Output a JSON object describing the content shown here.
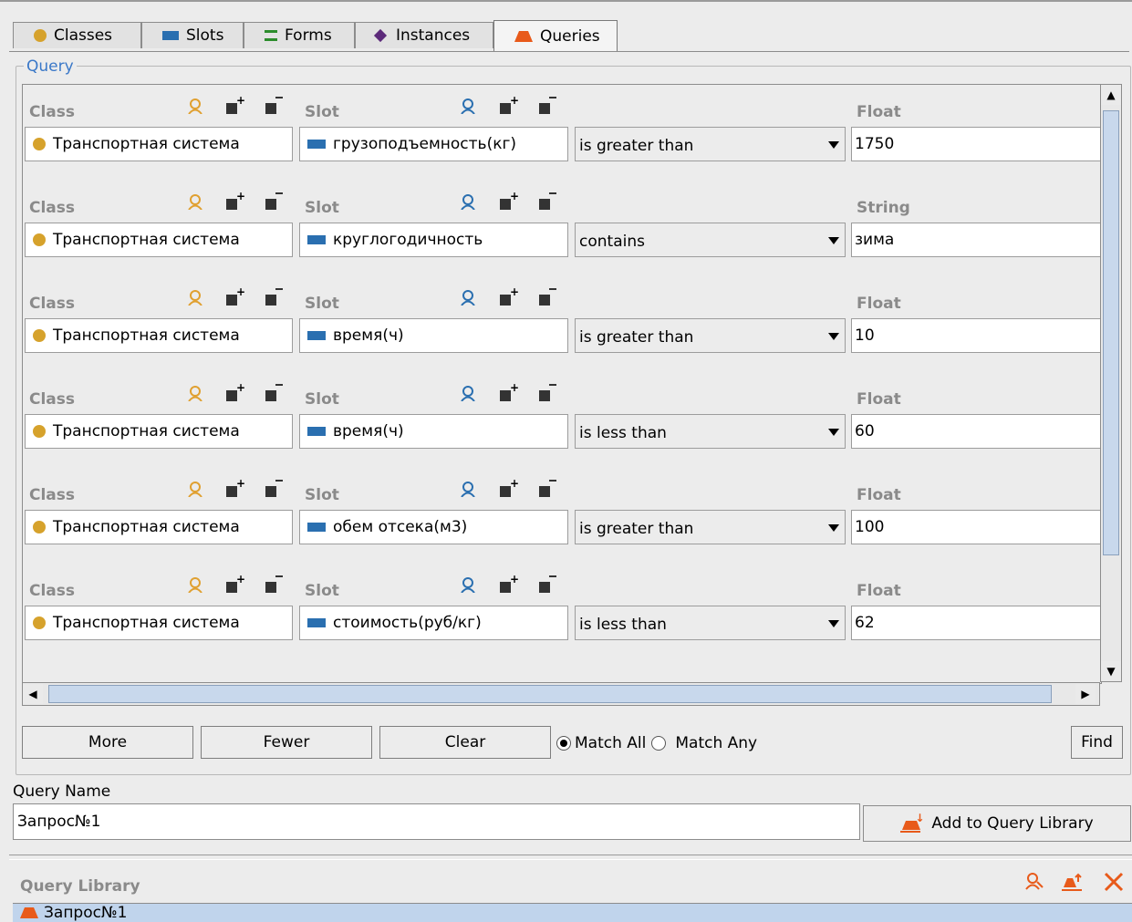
{
  "tabs": [
    {
      "label": "Classes",
      "icon": "class-dot-icon"
    },
    {
      "label": "Slots",
      "icon": "slot-icon"
    },
    {
      "label": "Forms",
      "icon": "form-icon"
    },
    {
      "label": "Instances",
      "icon": "instance-diamond-icon"
    },
    {
      "label": "Queries",
      "icon": "query-trapezoid-icon",
      "active": true
    }
  ],
  "query": {
    "legend": "Query",
    "rows": [
      {
        "class_label": "Class",
        "slot_label": "Slot",
        "type_label": "Float",
        "class_value": "Транспортная система",
        "slot_value": "грузоподъемность(кг)",
        "operator": "is greater than",
        "value": "1750"
      },
      {
        "class_label": "Class",
        "slot_label": "Slot",
        "type_label": "String",
        "class_value": "Транспортная система",
        "slot_value": "круглогодичность",
        "operator": "contains",
        "value": "зима"
      },
      {
        "class_label": "Class",
        "slot_label": "Slot",
        "type_label": "Float",
        "class_value": "Транспортная система",
        "slot_value": "время(ч)",
        "operator": "is greater than",
        "value": "10"
      },
      {
        "class_label": "Class",
        "slot_label": "Slot",
        "type_label": "Float",
        "class_value": "Транспортная система",
        "slot_value": "время(ч)",
        "operator": "is less than",
        "value": "60"
      },
      {
        "class_label": "Class",
        "slot_label": "Slot",
        "type_label": "Float",
        "class_value": "Транспортная система",
        "slot_value": "обем отсека(м3)",
        "operator": "is greater than",
        "value": "100"
      },
      {
        "class_label": "Class",
        "slot_label": "Slot",
        "type_label": "Float",
        "class_value": "Транспортная система",
        "slot_value": "стоимость(руб/кг)",
        "operator": "is less than",
        "value": "62"
      }
    ],
    "buttons": {
      "more": "More",
      "fewer": "Fewer",
      "clear": "Clear",
      "find": "Find"
    },
    "match_all": "Match All",
    "match_any": "Match Any",
    "match_selected": "all"
  },
  "query_name": {
    "label": "Query Name",
    "value": "Запрос№1",
    "add_button": "Add to Query Library"
  },
  "library": {
    "label": "Query Library",
    "items": [
      "Запрос№1"
    ]
  },
  "colors": {
    "class_dot": "#d6a22c",
    "slot": "#2a6fb0",
    "query": "#e85a1a",
    "link_blue": "#3a78c8"
  }
}
